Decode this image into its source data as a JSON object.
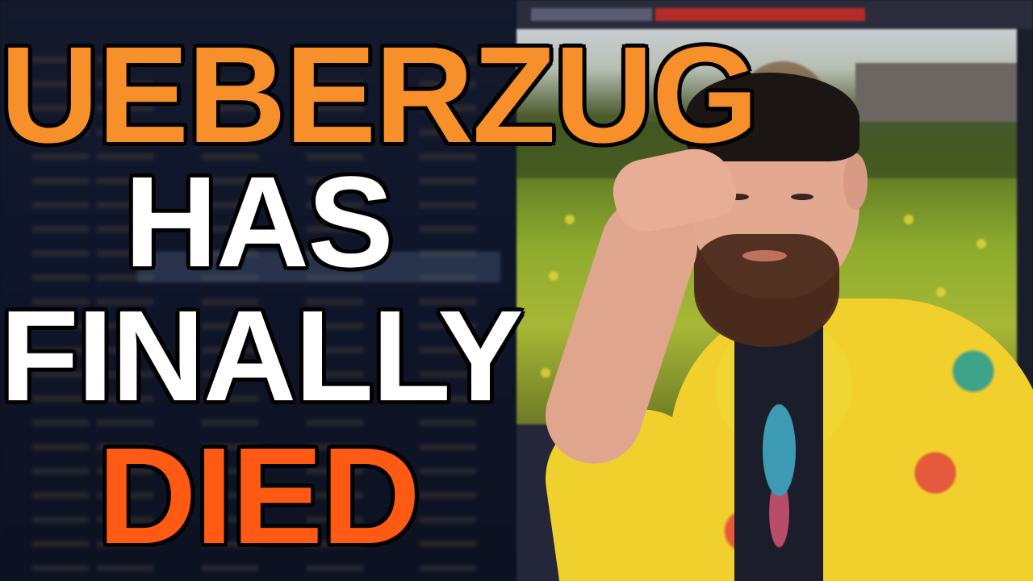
{
  "headline": {
    "line1": "UEBERZUG",
    "line2": "HAS",
    "line3": "FINALLY",
    "line4": "DIED"
  },
  "colors": {
    "accent_orange": "#f7902a",
    "accent_red_orange": "#ff5a13",
    "text_white": "#ffffff",
    "outline": "#000000"
  },
  "icons": {
    "background": "blurred terminal and image viewer",
    "person": "man facepalming in yellow floral shirt"
  }
}
